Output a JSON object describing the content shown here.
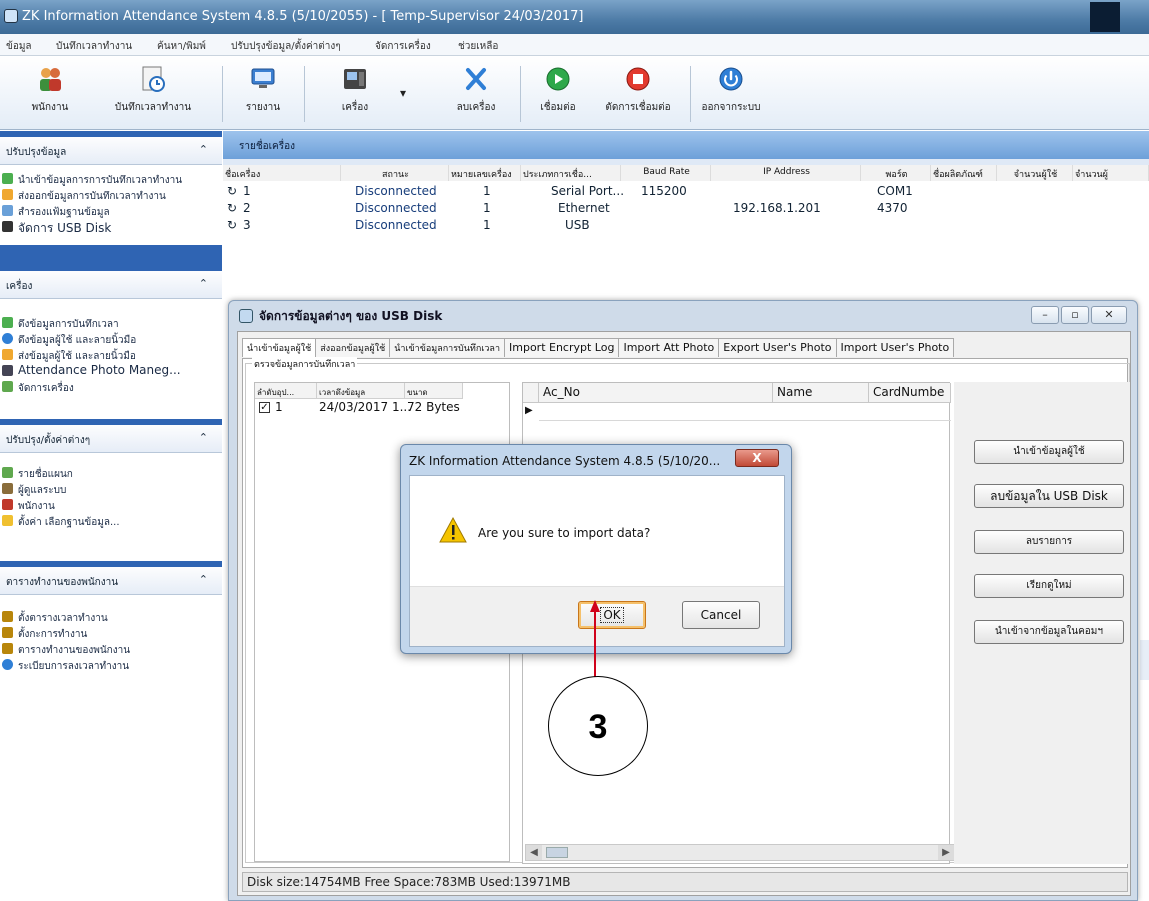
{
  "window": {
    "title": "ZK Information Attendance System 4.8.5 (5/10/2055) - [ Temp-Supervisor 24/03/2017]"
  },
  "menubar": {
    "items": [
      "ข้อมูล",
      "บันทึกเวลาทำงาน",
      "ค้นหา/พิมพ์",
      "ปรับปรุงข้อมูล/ตั้งค่าต่างๆ",
      "จัดการเครื่อง",
      "ช่วยเหลือ"
    ]
  },
  "toolbar": {
    "buttons": [
      {
        "label": "พนักงาน",
        "icon": "employees-icon"
      },
      {
        "label": "บันทึกเวลาทำงาน",
        "icon": "attendance-record-icon"
      },
      {
        "label": "รายงาน",
        "icon": "report-icon"
      },
      {
        "label": "เครื่อง",
        "icon": "device-icon"
      },
      {
        "label": "ลบเครื่อง",
        "icon": "delete-device-icon"
      },
      {
        "label": "เชื่อมต่อ",
        "icon": "connect-icon"
      },
      {
        "label": "ตัดการเชื่อมต่อ",
        "icon": "disconnect-icon"
      },
      {
        "label": "ออกจากระบบ",
        "icon": "power-icon"
      }
    ]
  },
  "sidebar": {
    "groups": [
      {
        "title": "ปรับปรุงข้อมูล",
        "items": [
          "นำเข้าข้อมูลการการบันทึกเวลาทำงาน",
          "ส่งออกข้อมูลการบันทึกเวลาทำงาน",
          "สำรองแฟ้มฐานข้อมูล",
          "จัดการ USB Disk"
        ]
      },
      {
        "title": "เครื่อง",
        "items": [
          "ดึงข้อมูลการบันทึกเวลา",
          "ดึงข้อมูลผู้ใช้ และลายนิ้วมือ",
          "ส่งข้อมูลผู้ใช้ และลายนิ้วมือ",
          "Attendance Photo Maneg...",
          "จัดการเครื่อง"
        ]
      },
      {
        "title": "ปรับปรุง/ตั้งค่าต่างๆ",
        "items": [
          "รายชื่อแผนก",
          "ผู้ดูแลระบบ",
          "พนักงาน",
          "ตั้งค่า เลือกฐานข้อมูล..."
        ]
      },
      {
        "title": "ตารางทำงานของพนักงาน",
        "items": [
          "ตั้งตารางเวลาทำงาน",
          "ตั้งกะการทำงาน",
          "ตารางทำงานของพนักงาน",
          "ระเบียบการลงเวลาทำงาน"
        ]
      }
    ]
  },
  "main": {
    "header": "รายชื่อเครื่อง",
    "columns": [
      "ชื่อเครื่อง",
      "สถานะ",
      "หมายเลขเครื่อง",
      "ประเภทการเชื่อ...",
      "Baud Rate",
      "IP Address",
      "พอร์ต",
      "ชื่อผลิตภัณฑ์",
      "จำนวนผู้ใช้",
      "จำนวนผู้"
    ],
    "rows": [
      {
        "name": "1",
        "status": "Disconnected",
        "number": "1",
        "conn": "Serial Port...",
        "baud": "115200",
        "ip": "",
        "port": "COM1"
      },
      {
        "name": "2",
        "status": "Disconnected",
        "number": "1",
        "conn": "Ethernet",
        "baud": "",
        "ip": "192.168.1.201",
        "port": "4370"
      },
      {
        "name": "3",
        "status": "Disconnected",
        "number": "1",
        "conn": "USB",
        "baud": "",
        "ip": "",
        "port": ""
      }
    ]
  },
  "usb_window": {
    "title": "จัดการข้อมูลต่างๆ ของ USB Disk",
    "tabs": [
      "นำเข้าข้อมูลผู้ใช้",
      "ส่งออกข้อมูลผู้ใช้",
      "นำเข้าข้อมูลการบันทึกเวลา",
      "Import Encrypt Log",
      "Import Att Photo",
      "Export User's Photo",
      "Import User's Photo"
    ],
    "fieldset_legend": "ตรวจข้อมูลการบันทึกเวลา",
    "left_columns": [
      "ลำดับอุป...",
      "เวลาดึงข้อมูล",
      "ขนาด"
    ],
    "left_row": {
      "checked": "✓",
      "index": "1",
      "time": "24/03/2017 1...",
      "size": "72 Bytes"
    },
    "right_columns": [
      "Ac_No",
      "Name",
      "CardNumbe"
    ],
    "action_buttons": [
      "นำเข้าข้อมูลผู้ใช้",
      "ลบข้อมูลใน USB Disk",
      "ลบรายการ",
      "เรียกดูใหม่",
      "นำเข้าจากข้อมูลในคอมฯ"
    ],
    "status": "Disk size:14754MB  Free Space:783MB  Used:13971MB"
  },
  "dialog": {
    "title": "ZK Information Attendance System 4.8.5 (5/10/20...",
    "message": "Are you sure to import data?",
    "ok": "OK",
    "cancel": "Cancel",
    "close": "X"
  },
  "annotation": {
    "step": "3",
    "color": "#d0021b"
  },
  "colors": {
    "sidebar_bg": "#2f64b3",
    "title_bar": "#4d7ba6",
    "main_header": "#6da0d9"
  }
}
